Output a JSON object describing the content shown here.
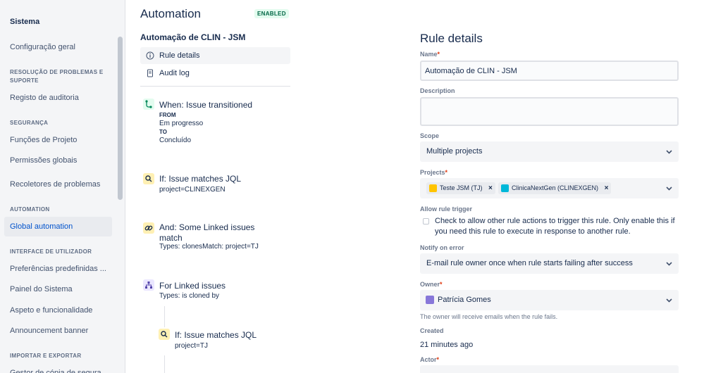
{
  "sidebar": {
    "title": "Sistema",
    "items": [
      {
        "label": "Configuração geral"
      },
      {
        "label": "Registo de auditoria"
      },
      {
        "label": "Funções de Projeto"
      },
      {
        "label": "Permissões globais"
      },
      {
        "label": "Recoletores de problemas"
      },
      {
        "label": "Global automation"
      },
      {
        "label": "Preferências predefinidas ..."
      },
      {
        "label": "Painel do Sistema"
      },
      {
        "label": "Aspeto e funcionalidade"
      },
      {
        "label": "Announcement banner"
      },
      {
        "label": "Gestor de cópia de segura..."
      }
    ],
    "sections": [
      "RESOLUÇÃO DE PROBLEMAS E SUPORTE",
      "SEGURANÇA",
      "AUTOMATION",
      "INTERFACE DE UTILIZADOR",
      "IMPORTAR E EXPORTAR"
    ]
  },
  "header": {
    "title": "Automation",
    "badge": "ENABLED"
  },
  "rule": {
    "name": "Automação de CLIN - JSM",
    "nav": [
      {
        "label": "Rule details"
      },
      {
        "label": "Audit log"
      }
    ],
    "components": [
      {
        "title": "When: Issue transitioned",
        "from_label": "FROM",
        "from": "Em progresso",
        "to_label": "TO",
        "to": "Concluído"
      },
      {
        "title": "If: Issue matches JQL",
        "text": "project=CLINEXGEN"
      },
      {
        "title": "And: Some Linked issues match",
        "text": "Types: clonesMatch: project=TJ"
      },
      {
        "title": "For Linked issues",
        "text": "Types: is cloned by"
      },
      {
        "title": "If: Issue matches JQL",
        "text": "project=TJ"
      }
    ]
  },
  "details": {
    "title": "Rule details",
    "name_label": "Name",
    "name_value": "Automação de CLIN - JSM",
    "description_label": "Description",
    "description_value": "",
    "scope_label": "Scope",
    "scope_value": "Multiple projects",
    "projects_label": "Projects",
    "projects": [
      {
        "label": "Teste JSM (TJ)"
      },
      {
        "label": "ClinicaNextGen (CLINEXGEN)"
      }
    ],
    "trigger_label": "Allow rule trigger",
    "trigger_text": "Check to allow other rule actions to trigger this rule. Only enable this if you need this rule to execute in response to another rule.",
    "notify_label": "Notify on error",
    "notify_value": "E-mail rule owner once when rule starts failing after success",
    "owner_label": "Owner",
    "owner_value": "Patrícia Gomes",
    "owner_help": "The owner will receive emails when the rule fails.",
    "created_label": "Created",
    "created_value": "21 minutes ago",
    "actor_label": "Actor"
  },
  "colors": {
    "accent": "#0052cc",
    "enabled_bg": "#e3fcef",
    "enabled_fg": "#006644",
    "trigger": "#36b37e",
    "condition": "#ffe380",
    "branch": "#c0b6f2"
  }
}
